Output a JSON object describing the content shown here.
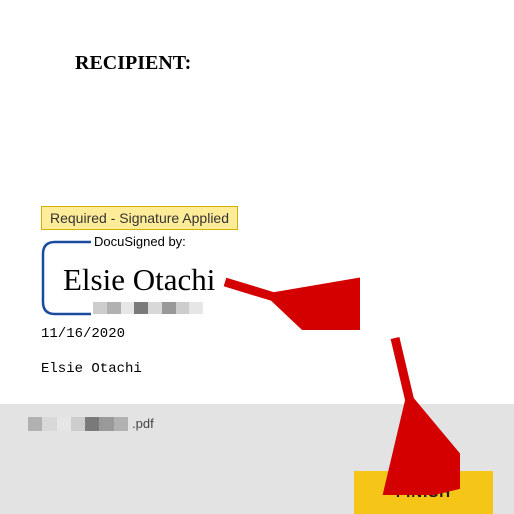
{
  "document": {
    "recipient_label": "RECIPIENT:",
    "status_text": "Required - Signature Applied",
    "docusigned_label": "DocuSigned by:",
    "signature_name": "Elsie Otachi",
    "date": "11/16/2020",
    "printed_name": "Elsie Otachi"
  },
  "footer": {
    "file_ext": ".pdf",
    "finish_label": "FINISH"
  }
}
